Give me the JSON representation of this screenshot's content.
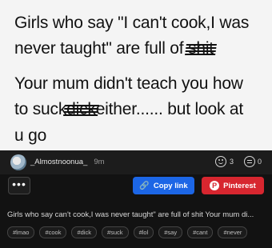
{
  "post": {
    "line1": "Girls who say \"I can't cook,I was",
    "line2_a": "never taught\" are full of ",
    "line2_censored": "shit",
    "line3": "Your mum didn't teach you how",
    "line4_a": "to suck",
    "line4_censored": "dick",
    "line4_b": "either...... but look at",
    "line5": "u go"
  },
  "meta": {
    "username": "_Almostnoonua_",
    "age": "9m",
    "reactions": "3",
    "comments": "0"
  },
  "actions": {
    "more": "•••",
    "copy_link": "Copy link",
    "pinterest": "Pinterest"
  },
  "caption": "Girls who say can't cook,I was never taught\" are full of shit Your mum di...",
  "tags": [
    "#lmao",
    "#cook",
    "#dick",
    "#suck",
    "#lol",
    "#say",
    "#cant",
    "#never"
  ]
}
